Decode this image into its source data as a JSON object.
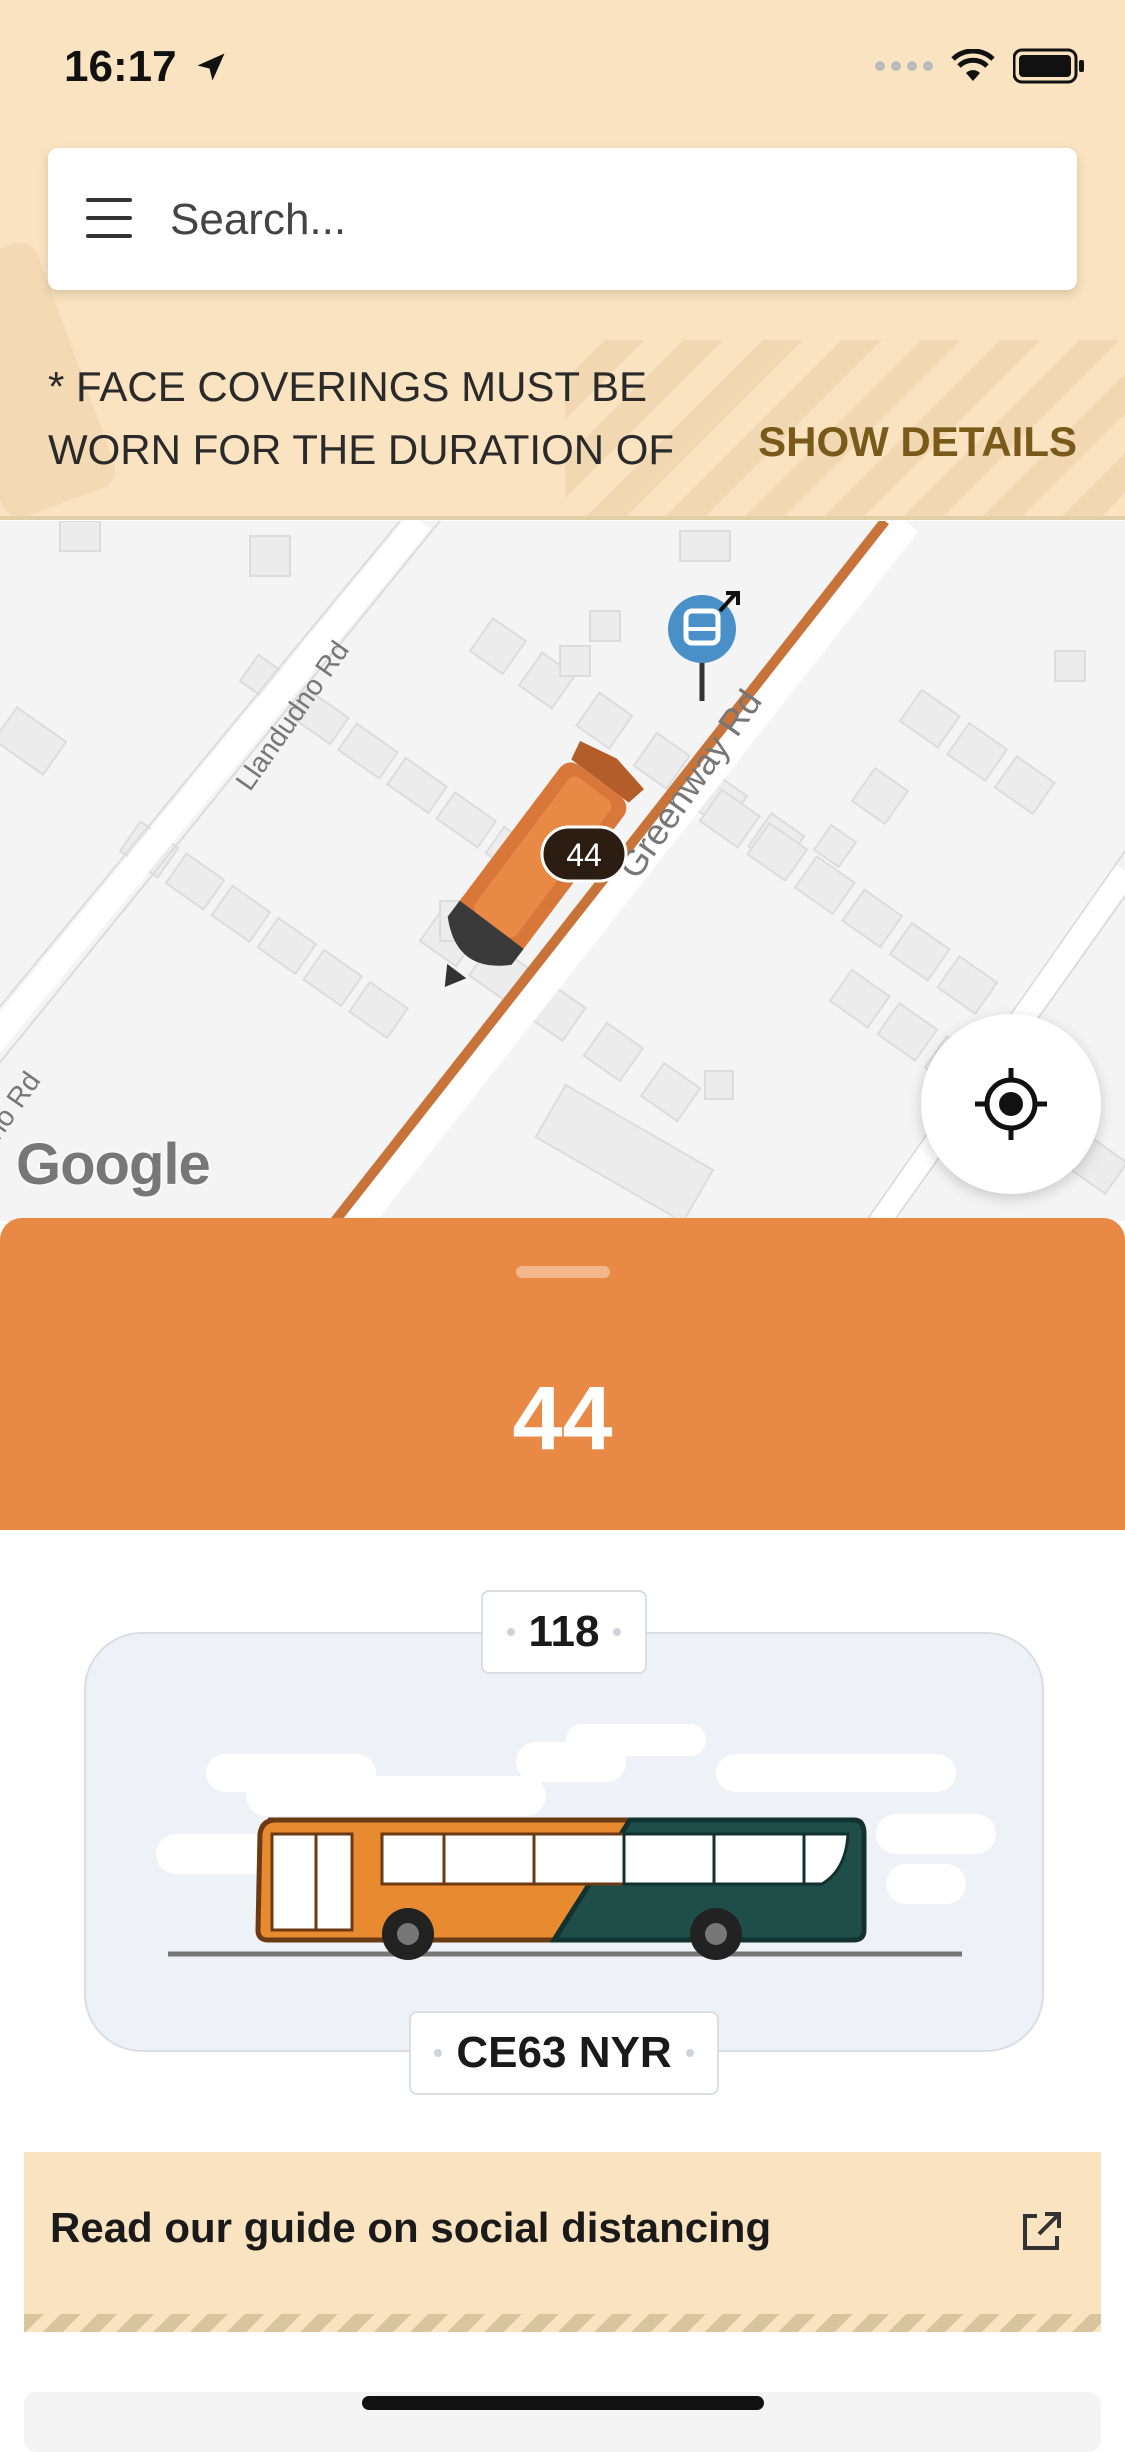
{
  "status_bar": {
    "time": "16:17"
  },
  "search": {
    "placeholder": "Search..."
  },
  "notice": {
    "text": "* FACE COVERINGS MUST BE WORN FOR THE DURATION OF",
    "action_label": "SHOW DETAILS"
  },
  "map": {
    "streets": [
      "Llandudno Rd",
      "Greenway Rd",
      "no Rd"
    ],
    "bus_marker_label": "44",
    "attribution": "Google"
  },
  "route": {
    "number": "44"
  },
  "vehicle": {
    "fleet_number": "118",
    "registration": "CE63 NYR",
    "livery": {
      "primary": "#e88a30",
      "secondary": "#1f4e4a"
    }
  },
  "guide": {
    "label": "Read our guide on social distancing"
  },
  "colors": {
    "header_bg": "#fae3c0",
    "accent": "#e88a45",
    "route_line": "#c8733a"
  }
}
